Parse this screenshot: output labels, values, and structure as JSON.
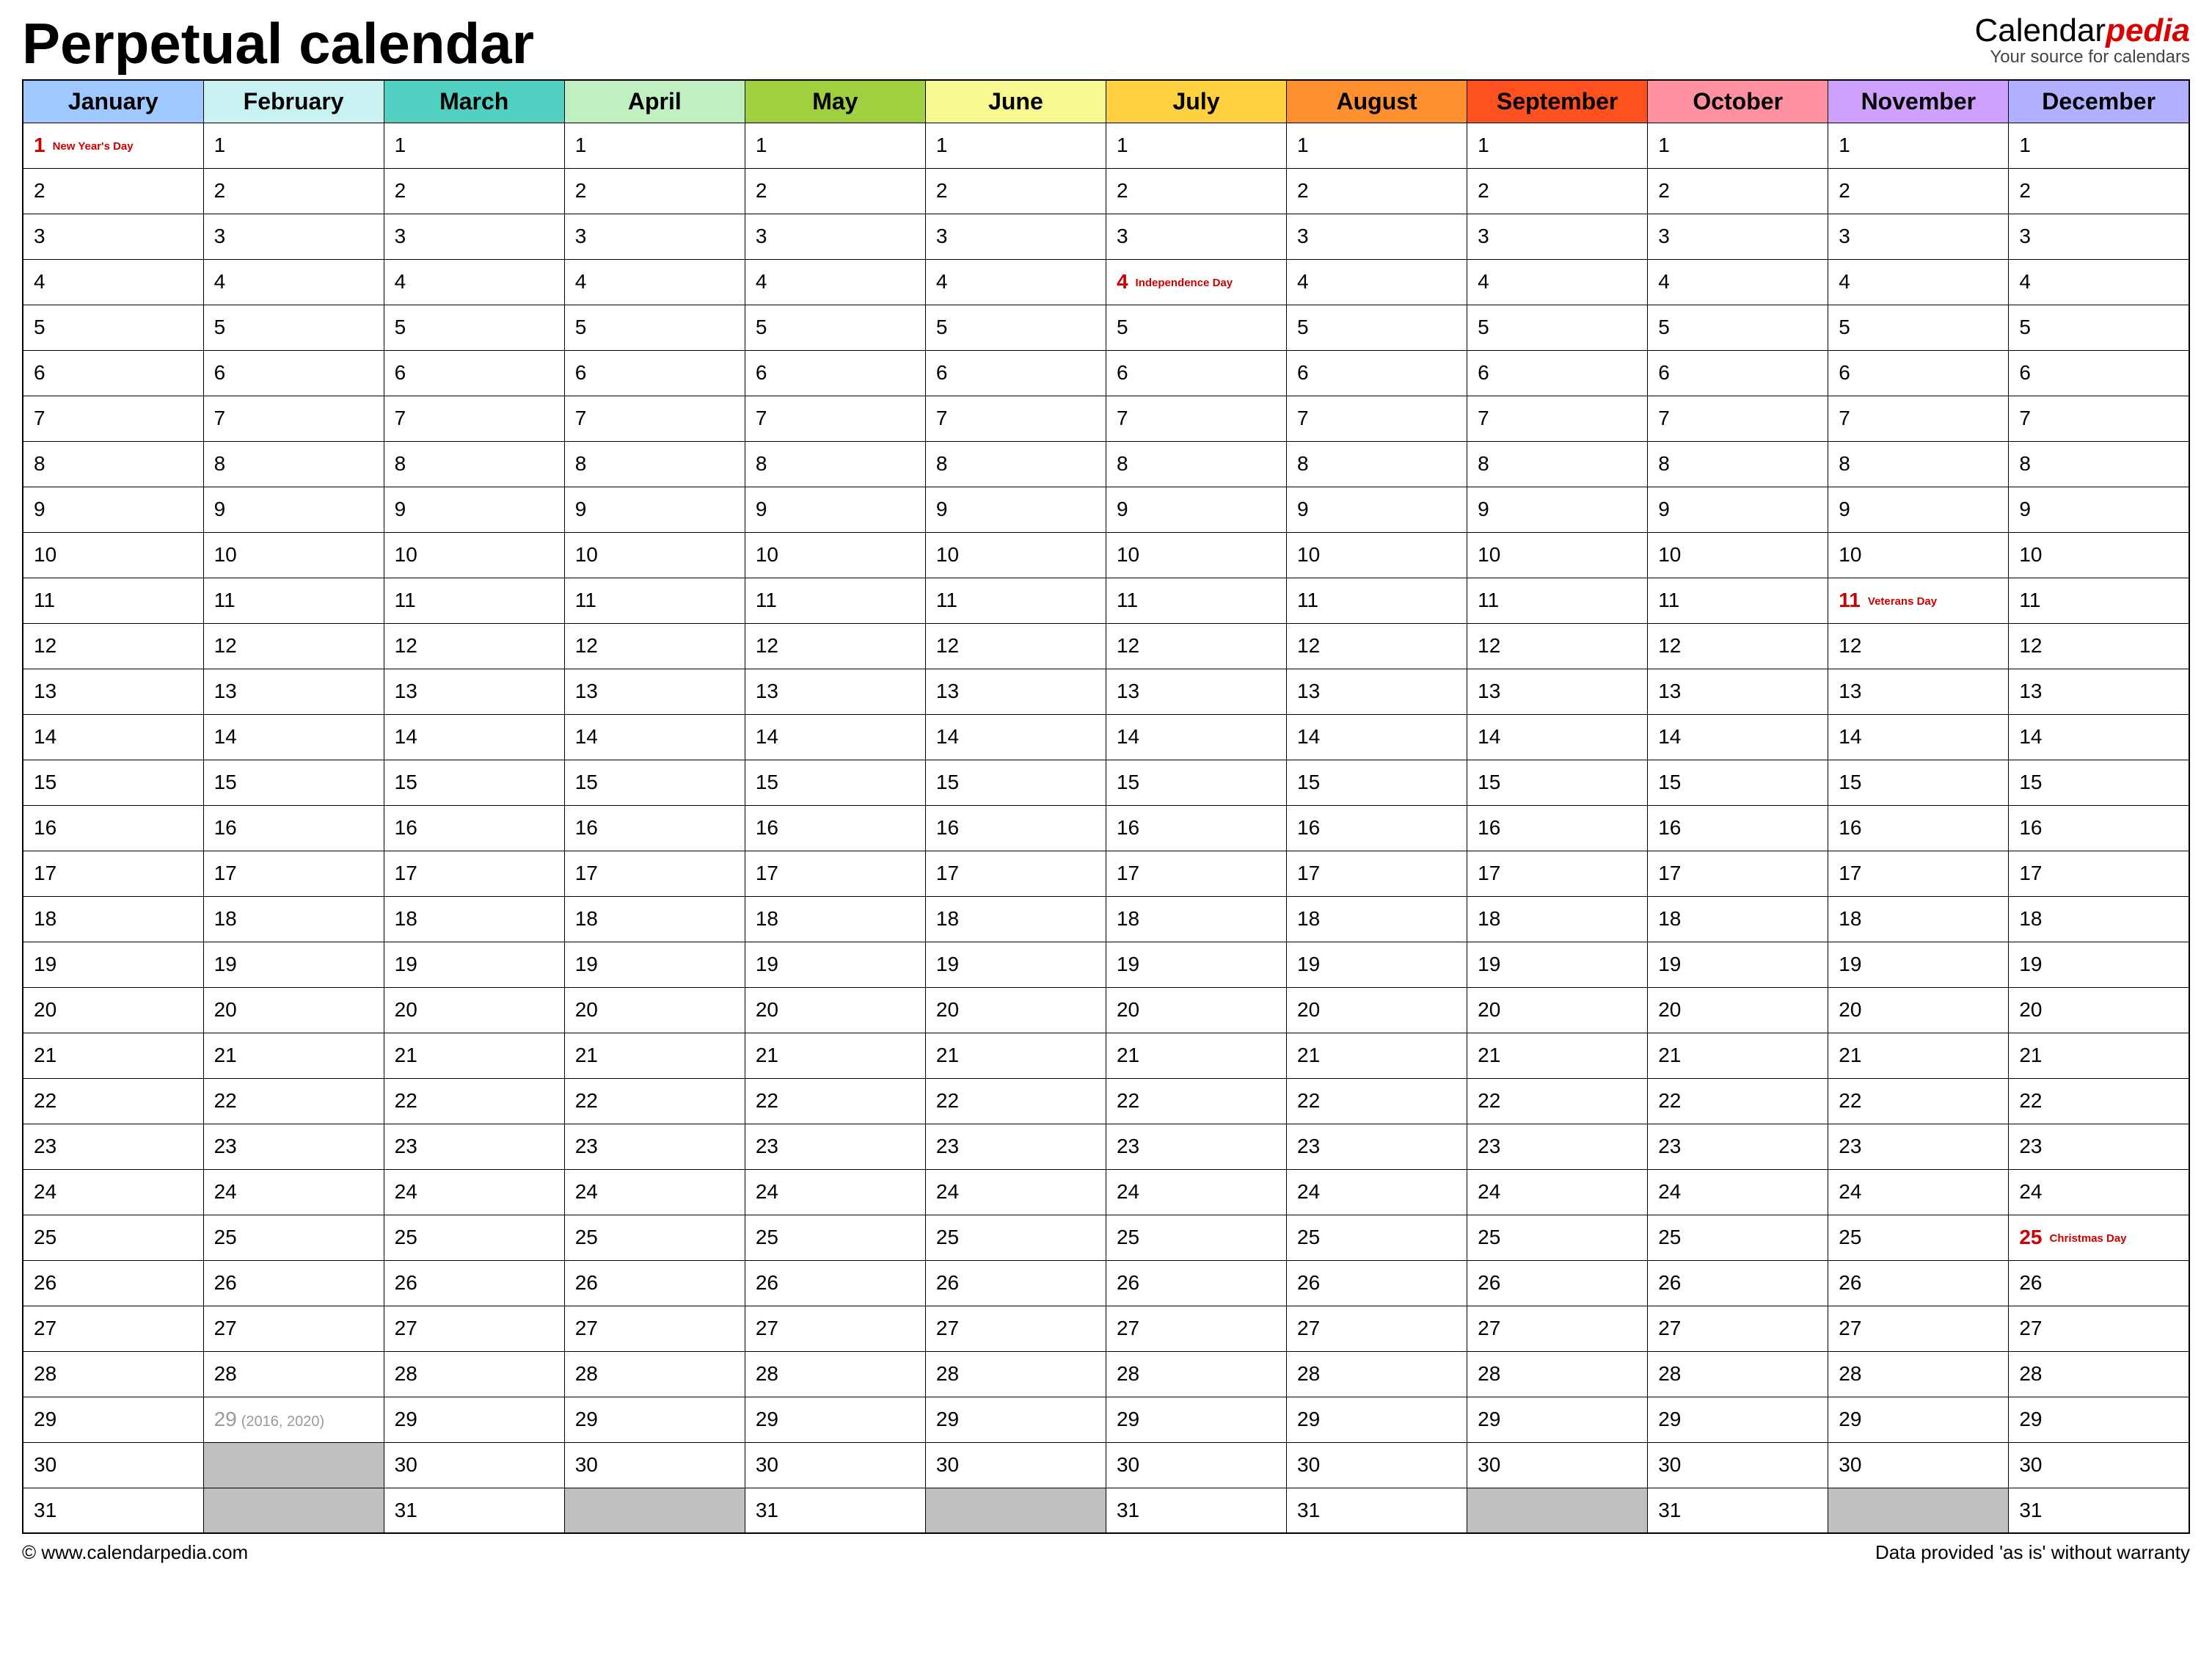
{
  "title": "Perpetual calendar",
  "brand": {
    "name_plain": "Calendar",
    "name_accent": "pedia",
    "tagline": "Your source for calendars"
  },
  "months": [
    {
      "name": "January",
      "color": "#9ec8ff",
      "days": 31
    },
    {
      "name": "February",
      "color": "#c8f2f2",
      "days": 28
    },
    {
      "name": "March",
      "color": "#4fd0c0",
      "days": 31
    },
    {
      "name": "April",
      "color": "#c0f0c0",
      "days": 30
    },
    {
      "name": "May",
      "color": "#a0d040",
      "days": 31
    },
    {
      "name": "June",
      "color": "#f8f890",
      "days": 30
    },
    {
      "name": "July",
      "color": "#ffd040",
      "days": 31
    },
    {
      "name": "August",
      "color": "#ff9030",
      "days": 31
    },
    {
      "name": "September",
      "color": "#ff5020",
      "days": 30
    },
    {
      "name": "October",
      "color": "#ff90a0",
      "days": 31
    },
    {
      "name": "November",
      "color": "#d0a0ff",
      "days": 30
    },
    {
      "name": "December",
      "color": "#b0b0ff",
      "days": 31
    }
  ],
  "max_rows": 31,
  "holidays": {
    "January-1": "New Year's Day",
    "July-4": "Independence Day",
    "November-11": "Veterans Day",
    "December-25": "Christmas Day"
  },
  "leap_cell": {
    "month": "February",
    "day": 29,
    "note": "(2016, 2020)"
  },
  "footer": {
    "left": "© www.calendarpedia.com",
    "right": "Data provided 'as is' without warranty"
  }
}
